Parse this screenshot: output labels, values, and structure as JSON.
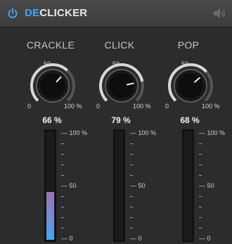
{
  "header": {
    "title_prefix": "DE",
    "title_rest": "CLICKER",
    "power_icon": "power-icon",
    "speaker_icon": "speaker-icon"
  },
  "colors": {
    "accent": "#3ea6ff",
    "meter_bottom": "#3fa9f0",
    "meter_top": "#9a73b8"
  },
  "sections": [
    {
      "label": "CRACKLE",
      "knob": {
        "min_label": "0",
        "mid_label": "50",
        "max_label": "100 %",
        "value_percent": 66,
        "value_text": "66 %"
      },
      "meter": {
        "level_percent": 44,
        "scale": {
          "top": "— 100 %",
          "mid": "— 50",
          "bottom": "— 0"
        }
      }
    },
    {
      "label": "CLICK",
      "knob": {
        "min_label": "0",
        "mid_label": "50",
        "max_label": "100 %",
        "value_percent": 79,
        "value_text": "79 %"
      },
      "meter": {
        "level_percent": 0,
        "scale": {
          "top": "— 100 %",
          "mid": "— 50",
          "bottom": "— 0"
        }
      }
    },
    {
      "label": "POP",
      "knob": {
        "min_label": "0",
        "mid_label": "50",
        "max_label": "100 %",
        "value_percent": 68,
        "value_text": "68 %"
      },
      "meter": {
        "level_percent": 0,
        "scale": {
          "top": "— 100 %",
          "mid": "— 50",
          "bottom": "— 0"
        }
      }
    }
  ]
}
